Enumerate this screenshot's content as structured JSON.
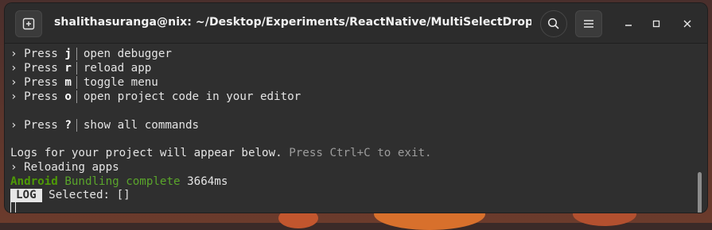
{
  "window": {
    "title": "shalithasuranga@nix: ~/Desktop/Experiments/ReactNative/MultiSelectDropdown...",
    "icons": [
      "new-tab-icon",
      "search-icon",
      "hamburger-menu-icon",
      "minimize-icon",
      "maximize-icon",
      "close-icon"
    ]
  },
  "terminal": {
    "commands": [
      {
        "prefix": "› Press ",
        "key": "j",
        "desc": "open debugger"
      },
      {
        "prefix": "› Press ",
        "key": "r",
        "desc": "reload app"
      },
      {
        "prefix": "› Press ",
        "key": "m",
        "desc": "toggle menu"
      },
      {
        "prefix": "› Press ",
        "key": "o",
        "desc": "open project code in your editor"
      },
      {
        "prefix": "› Press ",
        "key": "?",
        "desc": "show all commands"
      }
    ],
    "logs_intro": "Logs for your project will appear below.",
    "logs_exit_hint": "Press Ctrl+C to exit.",
    "reloading": "› Reloading apps",
    "bundle_platform": "Android",
    "bundle_status": "Bundling complete",
    "bundle_time": "3664ms",
    "log_badge": "LOG",
    "log_message": "Selected: []"
  },
  "colors": {
    "terminal_bg": "#2f2f2f",
    "text": "#e4e4e4",
    "dim_text": "#9c9c9c",
    "success_green": "#4e9a06"
  }
}
